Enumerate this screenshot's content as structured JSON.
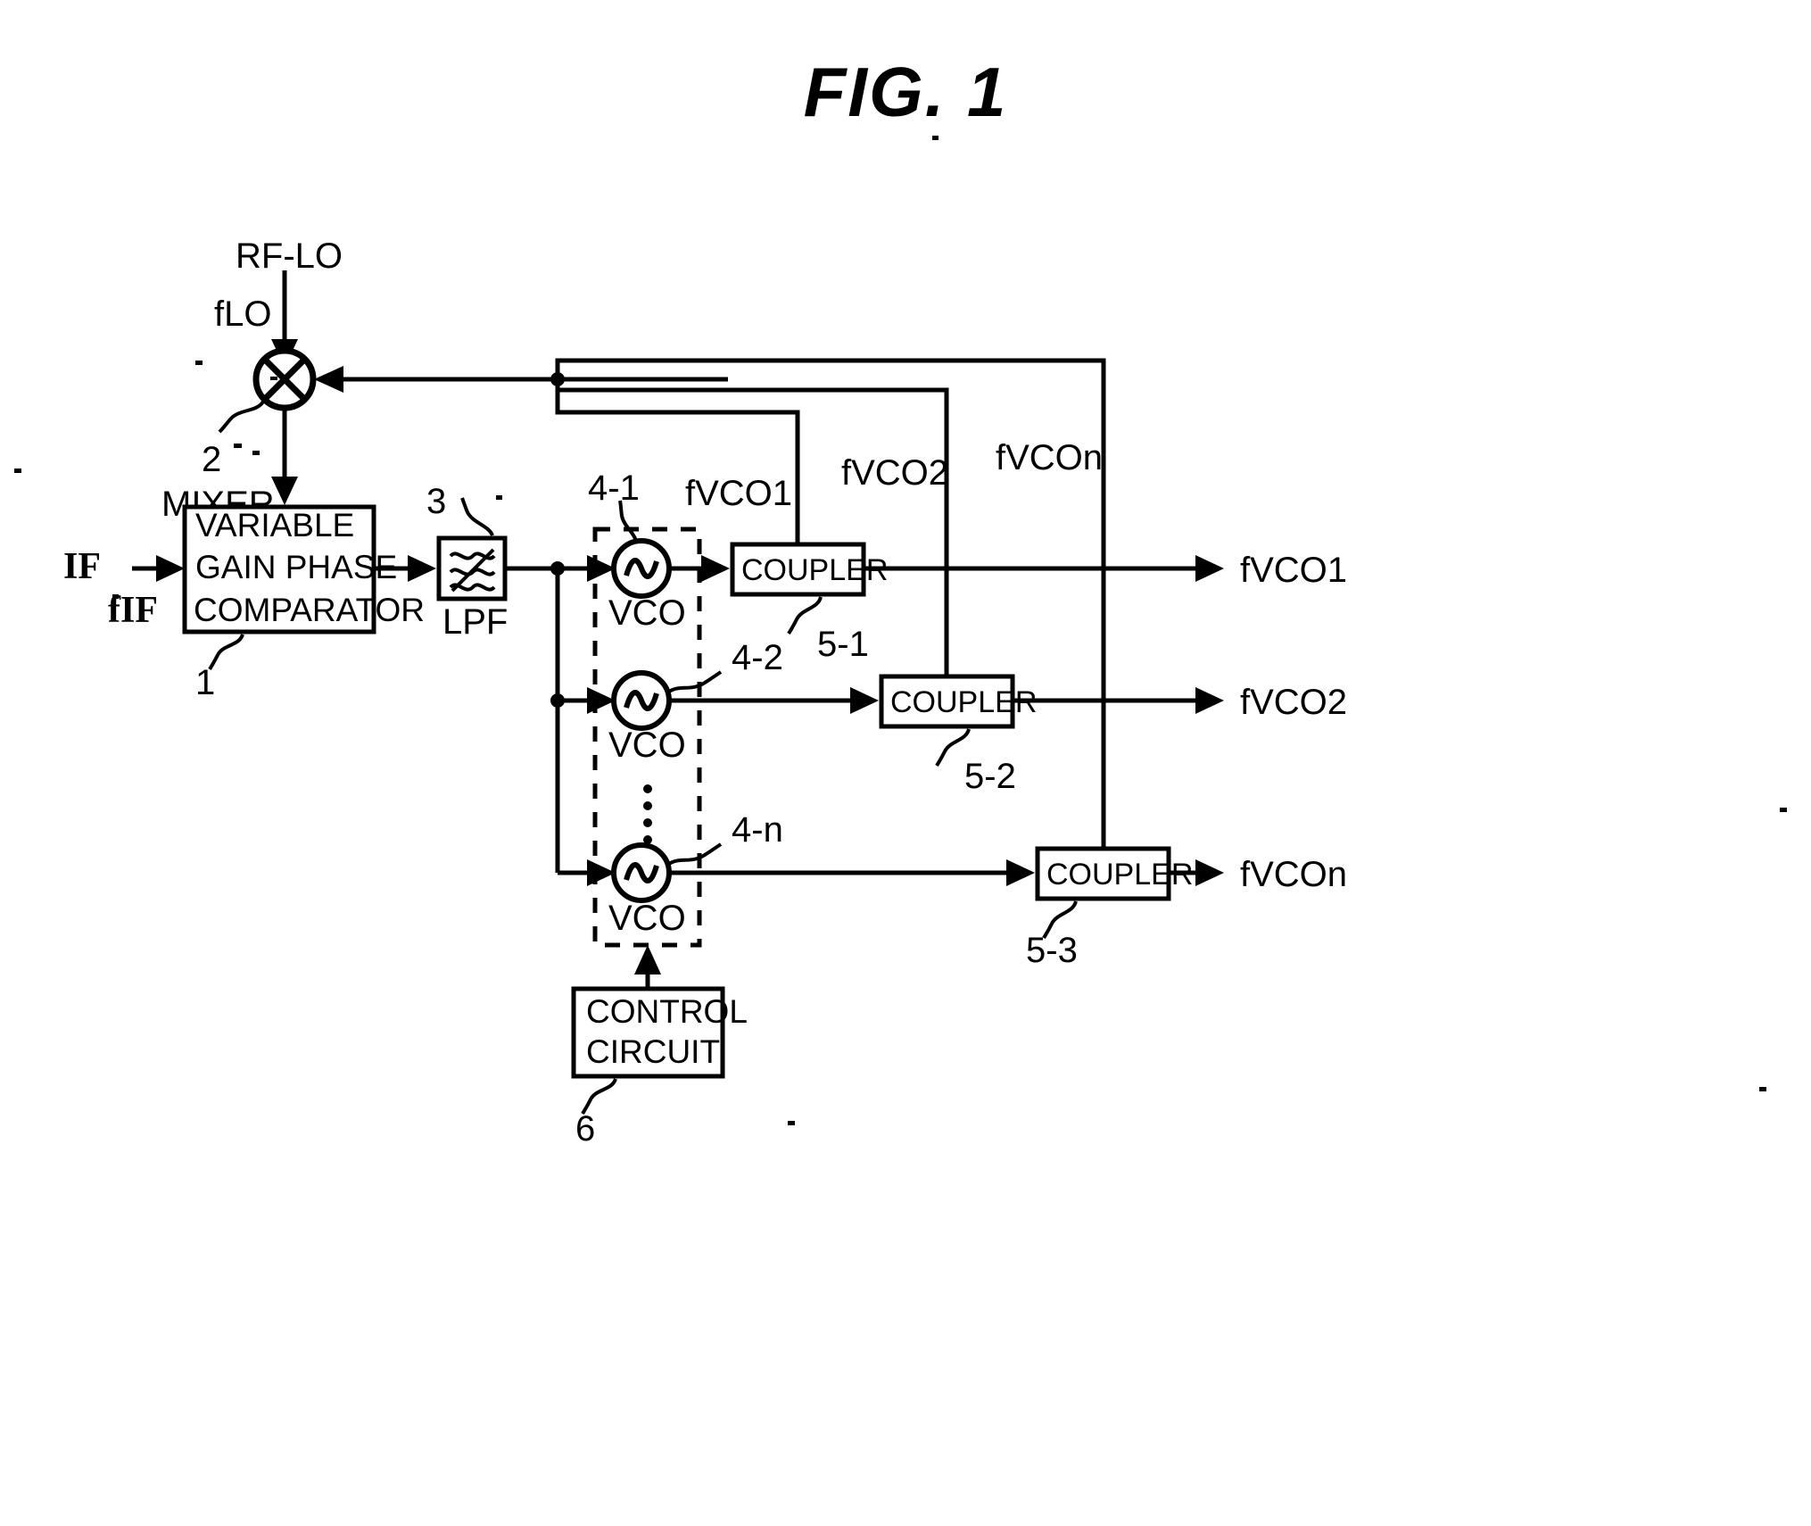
{
  "figure": {
    "title": "FIG.  1",
    "domain_label": "patent-block-diagram"
  },
  "inputs": {
    "rf_lo": "RF-LO",
    "f_lo": "fLO",
    "if": "IF",
    "f_if": "fIF"
  },
  "blocks": {
    "mixer": {
      "label": "MIXER",
      "ref": "2",
      "symbol": "mixer-circle-x"
    },
    "comparator": {
      "line1": "VARIABLE",
      "line2": "GAIN PHASE",
      "line3": "COMPARATOR",
      "ref": "1"
    },
    "lpf": {
      "label": "LPF",
      "ref": "3",
      "symbol": "lowpass-filter-glyph"
    },
    "vcos": [
      {
        "label": "VCO",
        "ref": "4-1"
      },
      {
        "label": "VCO",
        "ref": "4-2"
      },
      {
        "label": "VCO",
        "ref": "4-n"
      }
    ],
    "couplers": [
      {
        "label": "COUPLER",
        "ref": "5-1"
      },
      {
        "label": "COUPLER",
        "ref": "5-2"
      },
      {
        "label": "COUPLER",
        "ref": "5-3"
      }
    ],
    "control": {
      "line1": "CONTROL",
      "line2": "CIRCUIT",
      "ref": "6"
    }
  },
  "signals": {
    "feedback": [
      "fVCO1",
      "fVCO2",
      "fVCOn"
    ],
    "outputs": [
      "fVCO1",
      "fVCO2",
      "fVCOn"
    ]
  },
  "colors": {
    "ink": "#000000",
    "paper": "#ffffff"
  }
}
